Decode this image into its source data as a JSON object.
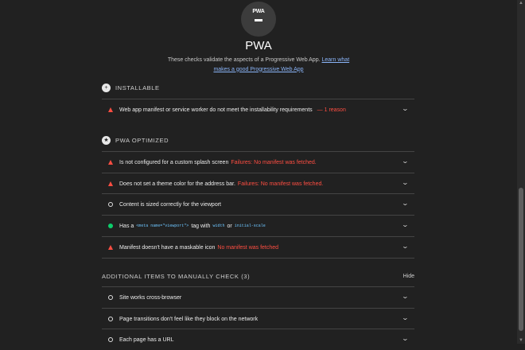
{
  "gauge": {
    "label": "PWA"
  },
  "title": "PWA",
  "description": {
    "text": "These checks validate the aspects of a Progressive Web App. ",
    "link_line1": "Learn what",
    "link_line2": "makes a good Progressive Web App"
  },
  "installable": {
    "label": "INSTALLABLE",
    "icon": "plus-circle-icon",
    "audits": [
      {
        "status": "fail",
        "text": "Web app manifest or service worker do not meet the installability requirements",
        "error": "— 1 reason"
      }
    ]
  },
  "pwa_optimized": {
    "label": "PWA OPTIMIZED",
    "icon": "star-circle-icon",
    "audits": [
      {
        "status": "fail",
        "text": "Is not configured for a custom splash screen",
        "error": "Failures: No manifest was fetched."
      },
      {
        "status": "fail",
        "text": "Does not set a theme color for the address bar.",
        "error": "Failures: No manifest was fetched."
      },
      {
        "status": "manual",
        "text": "Content is sized correctly for the viewport",
        "error": ""
      },
      {
        "status": "pass",
        "text_before": "Has a",
        "code1": "<meta name=\"viewport\">",
        "text_mid": "tag with",
        "code2": "width",
        "text_or": "or",
        "code3": "initial-scale"
      },
      {
        "status": "fail",
        "text": "Manifest doesn't have a maskable icon",
        "error": "No manifest was fetched"
      }
    ]
  },
  "manual": {
    "label": "ADDITIONAL ITEMS TO MANUALLY CHECK (3)",
    "hide_label": "Hide",
    "audits": [
      {
        "text": "Site works cross-browser"
      },
      {
        "text": "Page transitions don't feel like they block on the network"
      },
      {
        "text": "Each page has a URL"
      }
    ]
  },
  "colors": {
    "fail": "#ff4e42",
    "pass": "#0cce6b",
    "link": "#8ab4f8",
    "background": "#212121"
  }
}
